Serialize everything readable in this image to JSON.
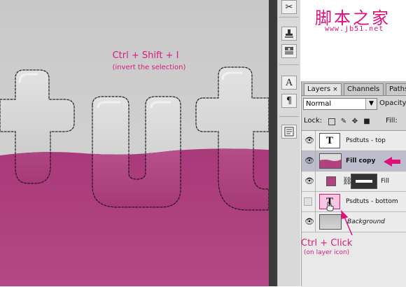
{
  "canvas": {
    "annotation_main": "Ctrl + Shift + I",
    "annotation_sub": "(invert the selection)",
    "text_art": "tut",
    "colors": {
      "top_bg": "#cfcfcf",
      "fill_magenta": "#b2427f",
      "text_glass": "#d6d6d6"
    }
  },
  "callout": {
    "main": "Ctrl + Click",
    "sub": "(on layer icon)",
    "color": "#d81b7a"
  },
  "watermark": {
    "title": "脚本之家",
    "url": "www.jb51.net"
  },
  "tools": [
    {
      "icon": "scissors-icon"
    },
    {
      "icon": "clone-stamp-icon"
    },
    {
      "icon": "history-brush-icon"
    },
    {
      "icon": "type-tool-icon",
      "glyph": "A"
    },
    {
      "icon": "pilcrow-icon",
      "glyph": "¶"
    },
    {
      "icon": "notes-icon"
    }
  ],
  "panel": {
    "tabs": [
      {
        "label": "Layers",
        "active": true,
        "close": "×"
      },
      {
        "label": "Channels",
        "active": false
      },
      {
        "label": "Paths",
        "active": false
      }
    ],
    "blend_mode": "Normal",
    "opacity_label": "Opacity:",
    "lock_label": "Lock:",
    "fill_label": "Fill:",
    "layers": [
      {
        "name": "Psdtuts - top",
        "type": "text",
        "thumb": "T",
        "visible": true,
        "selected": false
      },
      {
        "name": "Fill copy",
        "type": "raster",
        "visible": true,
        "selected": true
      },
      {
        "name": "Fill",
        "type": "fill-with-mask",
        "visible": true,
        "selected": false
      },
      {
        "name": "Psdtuts - bottom",
        "type": "text",
        "thumb": "T",
        "visible": false,
        "selected": false
      },
      {
        "name": "Background",
        "type": "background",
        "visible": true,
        "selected": false
      }
    ]
  }
}
